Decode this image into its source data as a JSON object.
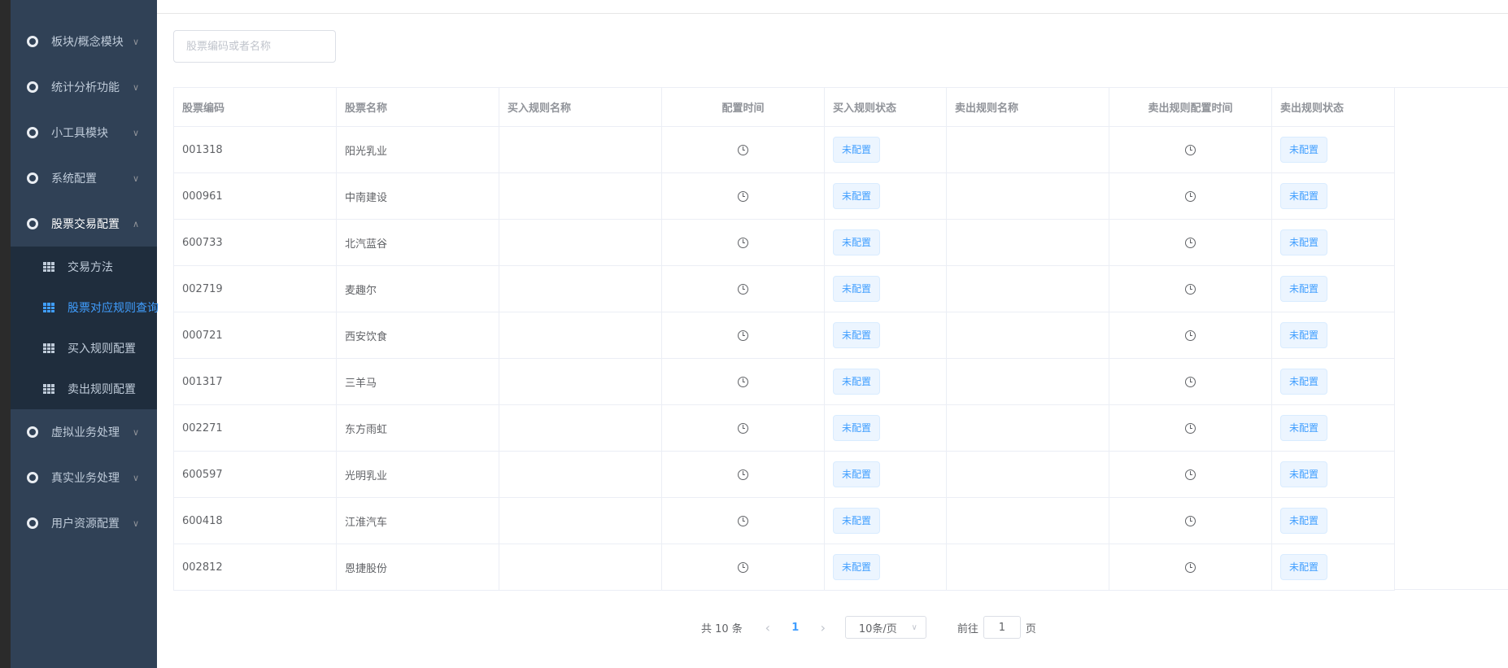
{
  "sidebar": {
    "menu": [
      {
        "label": "板块/概念模块",
        "expanded": false
      },
      {
        "label": "统计分析功能",
        "expanded": false
      },
      {
        "label": "小工具模块",
        "expanded": false
      },
      {
        "label": "系统配置",
        "expanded": false
      },
      {
        "label": "股票交易配置",
        "expanded": true
      },
      {
        "label": "虚拟业务处理",
        "expanded": false
      },
      {
        "label": "真实业务处理",
        "expanded": false
      },
      {
        "label": "用户资源配置",
        "expanded": false
      }
    ],
    "submenu": [
      {
        "label": "交易方法",
        "active": false
      },
      {
        "label": "股票对应规则查询",
        "active": true
      },
      {
        "label": "买入规则配置",
        "active": false
      },
      {
        "label": "卖出规则配置",
        "active": false
      }
    ],
    "colors": {
      "bg": "#304156",
      "sub_bg": "#1f2d3d",
      "active": "#409eff"
    }
  },
  "search": {
    "placeholder": "股票编码或者名称",
    "value": ""
  },
  "table": {
    "columns": [
      "股票编码",
      "股票名称",
      "买入规则名称",
      "配置时间",
      "买入规则状态",
      "卖出规则名称",
      "卖出规则配置时间",
      "卖出规则状态"
    ],
    "rows": [
      {
        "code": "001318",
        "name": "阳光乳业",
        "buy_rule": "",
        "buy_status": "未配置",
        "sell_rule": "",
        "sell_status": "未配置"
      },
      {
        "code": "000961",
        "name": "中南建设",
        "buy_rule": "",
        "buy_status": "未配置",
        "sell_rule": "",
        "sell_status": "未配置"
      },
      {
        "code": "600733",
        "name": "北汽蓝谷",
        "buy_rule": "",
        "buy_status": "未配置",
        "sell_rule": "",
        "sell_status": "未配置"
      },
      {
        "code": "002719",
        "name": "麦趣尔",
        "buy_rule": "",
        "buy_status": "未配置",
        "sell_rule": "",
        "sell_status": "未配置"
      },
      {
        "code": "000721",
        "name": "西安饮食",
        "buy_rule": "",
        "buy_status": "未配置",
        "sell_rule": "",
        "sell_status": "未配置"
      },
      {
        "code": "001317",
        "name": "三羊马",
        "buy_rule": "",
        "buy_status": "未配置",
        "sell_rule": "",
        "sell_status": "未配置"
      },
      {
        "code": "002271",
        "name": "东方雨虹",
        "buy_rule": "",
        "buy_status": "未配置",
        "sell_rule": "",
        "sell_status": "未配置"
      },
      {
        "code": "600597",
        "name": "光明乳业",
        "buy_rule": "",
        "buy_status": "未配置",
        "sell_rule": "",
        "sell_status": "未配置"
      },
      {
        "code": "600418",
        "name": "江淮汽车",
        "buy_rule": "",
        "buy_status": "未配置",
        "sell_rule": "",
        "sell_status": "未配置"
      },
      {
        "code": "002812",
        "name": "恩捷股份",
        "buy_rule": "",
        "buy_status": "未配置",
        "sell_rule": "",
        "sell_status": "未配置"
      }
    ],
    "tag_color": "#409eff"
  },
  "pagination": {
    "total_text": "共 10 条",
    "current_page": "1",
    "page_size": "10条/页",
    "goto_prefix": "前往",
    "goto_value": "1",
    "goto_suffix": "页"
  }
}
